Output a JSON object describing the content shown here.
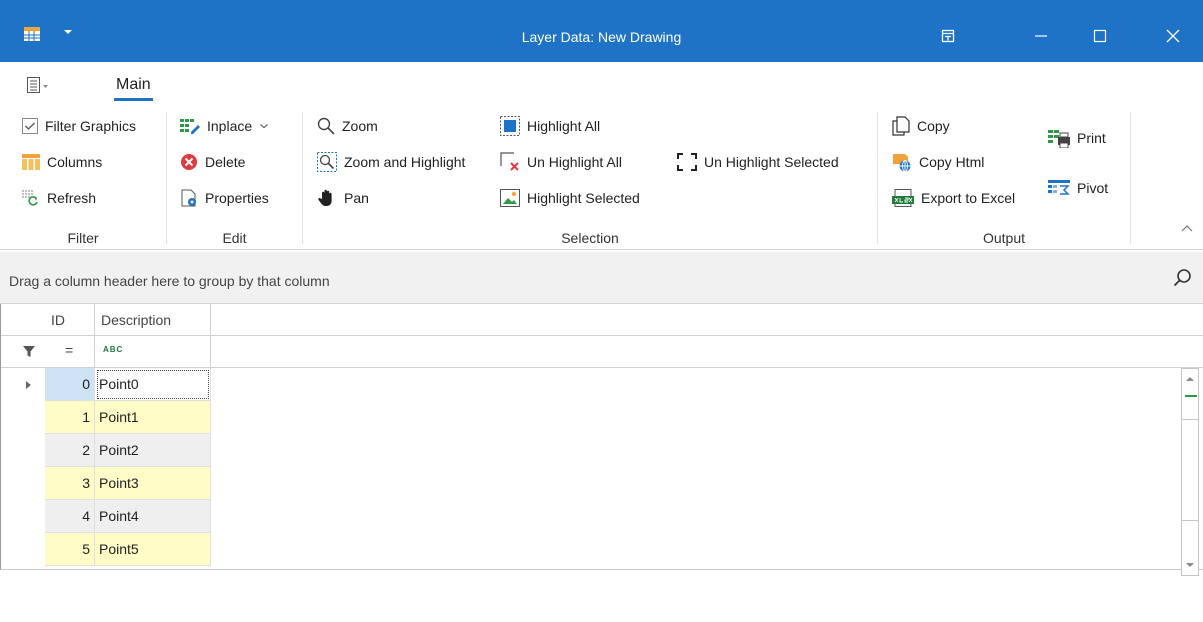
{
  "window": {
    "title": "Layer Data: New Drawing"
  },
  "ribbon": {
    "tab_main": "Main",
    "groups": {
      "filter": {
        "label": "Filter",
        "filter_graphics": "Filter Graphics",
        "columns": "Columns",
        "refresh": "Refresh"
      },
      "edit": {
        "label": "Edit",
        "inplace": "Inplace",
        "delete": "Delete",
        "properties": "Properties"
      },
      "selection": {
        "label": "Selection",
        "zoom": "Zoom",
        "zoom_highlight": "Zoom and Highlight",
        "pan": "Pan",
        "highlight_all": "Highlight All",
        "unhighlight_all": "Un Highlight All",
        "highlight_selected": "Highlight Selected",
        "unhighlight_selected": "Un Highlight Selected"
      },
      "output": {
        "label": "Output",
        "copy": "Copy",
        "copy_html": "Copy Html",
        "export_excel": "Export to Excel",
        "print": "Print",
        "pivot": "Pivot"
      }
    }
  },
  "group_panel": {
    "hint": "Drag a column header here to group by that column"
  },
  "grid": {
    "columns": [
      "ID",
      "Description"
    ],
    "rows": [
      {
        "id": "0",
        "desc": "Point0"
      },
      {
        "id": "1",
        "desc": "Point1"
      },
      {
        "id": "2",
        "desc": "Point2"
      },
      {
        "id": "3",
        "desc": "Point3"
      },
      {
        "id": "4",
        "desc": "Point4"
      },
      {
        "id": "5",
        "desc": "Point5"
      }
    ],
    "filter_operator": "=",
    "filter_type_glyph": "ABC"
  },
  "colors": {
    "titlebar": "#1e73c6",
    "odd_row": "#fffcc8",
    "even_row": "#efefef",
    "selected_id": "#cfe3f5"
  }
}
